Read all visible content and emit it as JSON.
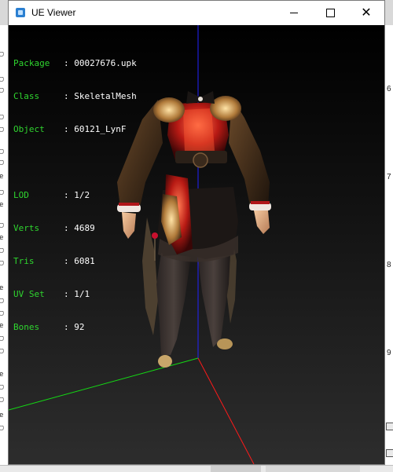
{
  "window": {
    "title": "UE Viewer"
  },
  "titlebar_icons": [
    "minimize-icon",
    "maximize-icon",
    "close-icon"
  ],
  "info_group1": [
    {
      "key": "Package",
      "value": "00027676.upk"
    },
    {
      "key": "Class",
      "value": "SkeletalMesh"
    },
    {
      "key": "Object",
      "value": "60121_LynF"
    }
  ],
  "info_group2": [
    {
      "key": "LOD",
      "value": "1/2"
    },
    {
      "key": "Verts",
      "value": "4689"
    },
    {
      "key": "Tris",
      "value": "6081"
    },
    {
      "key": "UV Set",
      "value": "1/1"
    },
    {
      "key": "Bones",
      "value": "92"
    }
  ],
  "axis_colors": {
    "x": "#ff1a1a",
    "y": "#14d914",
    "z": "#2222ff"
  },
  "background_right_ticks": [
    "6",
    "7",
    "8",
    "9"
  ],
  "background_left_marks": [
    "e",
    "e",
    "e",
    "e",
    "e",
    "e",
    "e"
  ]
}
